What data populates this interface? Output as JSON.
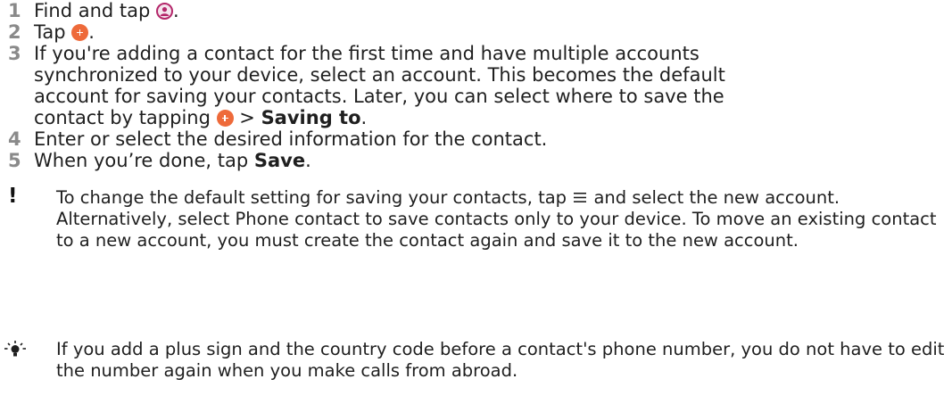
{
  "steps": [
    {
      "num": "1",
      "text_before": "Find and tap ",
      "icon": "contacts-app-icon",
      "text_after": "."
    },
    {
      "num": "2",
      "text_before": "Tap ",
      "icon": "add-contact-icon",
      "text_after": "."
    },
    {
      "num": "3",
      "text": "If you're adding a contact for the first time and have multiple accounts synchronized to your device, select an account. This becomes the default account for saving your contacts. Later, you can select where to save the contact by tapping ",
      "icon": "add-contact-icon",
      "separator": " > ",
      "bold": "Saving to",
      "text_after": "."
    },
    {
      "num": "4",
      "text": "Enter or select the desired information for the contact."
    },
    {
      "num": "5",
      "text_before": "When you’re done, tap ",
      "bold": "Save",
      "text_after": "."
    }
  ],
  "note_important": {
    "icon": "exclamation-icon",
    "text_before": "To change the default setting for saving your contacts, tap ",
    "glyph": "menu-icon",
    "text_after": " and select the new account. Alternatively, select Phone contact to save contacts only to your device. To move an existing contact to a new account, you must create the contact again and save it to the new account."
  },
  "note_tip": {
    "icon": "lightbulb-icon",
    "text": "If you add a plus sign and the country code before a contact's phone number, you do not have to edit the number again when you make calls from abroad."
  },
  "colors": {
    "step_number": "#8a8a8a",
    "contacts_icon": "#b4276a",
    "add_icon": "#ee6a3a",
    "text": "#1f1f1f"
  }
}
